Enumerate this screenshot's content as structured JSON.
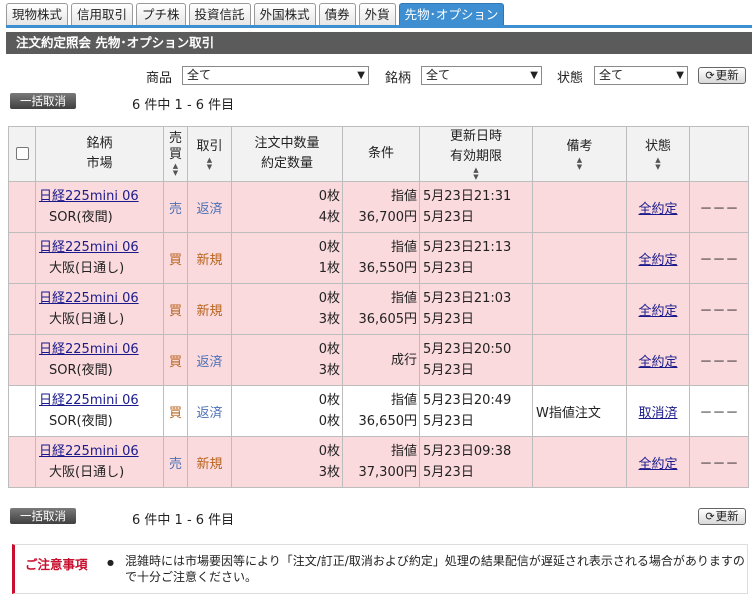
{
  "tabs": [
    "現物株式",
    "信用取引",
    "プチ株",
    "投資信託",
    "外国株式",
    "債券",
    "外貨",
    "先物･オプション"
  ],
  "title": "注文約定照会 先物･オプション取引",
  "filters": {
    "product_label": "商品",
    "product_value": "全て",
    "brand_label": "銘柄",
    "brand_value": "全て",
    "status_label": "状態",
    "status_value": "全て",
    "refresh_label": "更新"
  },
  "bulk_cancel_label": "一括取消",
  "count_text": "6 件中 1 - 6 件目",
  "headers": {
    "brand": "銘柄",
    "market": "市場",
    "side1": "売",
    "side2": "買",
    "trade": "取引",
    "qty1": "注文中数量",
    "qty2": "約定数量",
    "condition": "条件",
    "updated1": "更新日時",
    "updated2": "有効期限",
    "remarks": "備考",
    "status": "状態"
  },
  "rows": [
    {
      "brand": "日経225mini 06",
      "market": "SOR(夜間)",
      "side": "売",
      "trade": "返済",
      "qty_open": "0枚",
      "qty_filled": "4枚",
      "cond_type": "指値",
      "cond_price": "36,700円",
      "updated": "5月23日21:31",
      "expiry": "5月23日",
      "remarks": "",
      "status": "全約定",
      "action": "－－－"
    },
    {
      "brand": "日経225mini 06",
      "market": "大阪(日通し)",
      "side": "買",
      "trade": "新規",
      "qty_open": "0枚",
      "qty_filled": "1枚",
      "cond_type": "指値",
      "cond_price": "36,550円",
      "updated": "5月23日21:13",
      "expiry": "5月23日",
      "remarks": "",
      "status": "全約定",
      "action": "－－－"
    },
    {
      "brand": "日経225mini 06",
      "market": "大阪(日通し)",
      "side": "買",
      "trade": "新規",
      "qty_open": "0枚",
      "qty_filled": "3枚",
      "cond_type": "指値",
      "cond_price": "36,605円",
      "updated": "5月23日21:03",
      "expiry": "5月23日",
      "remarks": "",
      "status": "全約定",
      "action": "－－－"
    },
    {
      "brand": "日経225mini 06",
      "market": "SOR(夜間)",
      "side": "買",
      "trade": "返済",
      "qty_open": "0枚",
      "qty_filled": "3枚",
      "cond_type": "成行",
      "cond_price": "",
      "updated": "5月23日20:50",
      "expiry": "5月23日",
      "remarks": "",
      "status": "全約定",
      "action": "－－－"
    },
    {
      "brand": "日経225mini 06",
      "market": "SOR(夜間)",
      "side": "買",
      "trade": "返済",
      "qty_open": "0枚",
      "qty_filled": "0枚",
      "cond_type": "指値",
      "cond_price": "36,650円",
      "updated": "5月23日20:49",
      "expiry": "5月23日",
      "remarks": "W指値注文",
      "status": "取消済",
      "action": "－－－"
    },
    {
      "brand": "日経225mini 06",
      "market": "大阪(日通し)",
      "side": "売",
      "trade": "新規",
      "qty_open": "0枚",
      "qty_filled": "3枚",
      "cond_type": "指値",
      "cond_price": "37,300円",
      "updated": "5月23日09:38",
      "expiry": "5月23日",
      "remarks": "",
      "status": "全約定",
      "action": "－－－"
    }
  ],
  "notice": {
    "title": "ご注意事項",
    "text": "混雑時には市場要因等により「注文/訂正/取消および約定」処理の結果配信が遅延され表示される場合がありますので十分ご注意ください。"
  },
  "colors": {
    "tab_active": "#3d8fd1",
    "row_highlight": "#fadadd",
    "notice_accent": "#c8102e"
  }
}
